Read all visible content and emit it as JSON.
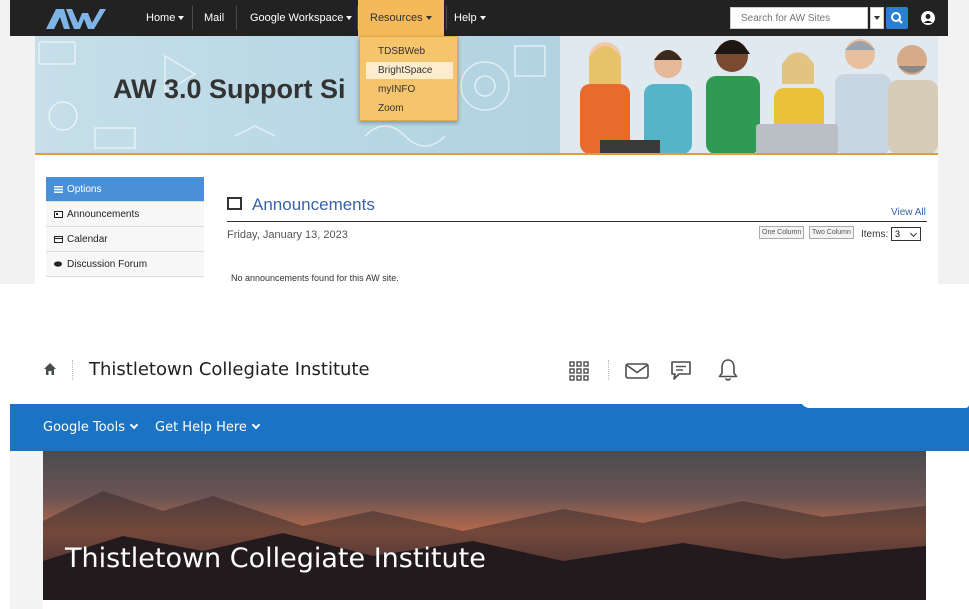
{
  "aw_site": {
    "nav": {
      "home": "Home",
      "mail": "Mail",
      "google_workspace": "Google Workspace",
      "resources": "Resources",
      "help": "Help",
      "search_placeholder": "Search for AW Sites"
    },
    "resources_menu": [
      "TDSBWeb",
      "BrightSpace",
      "myINFO",
      "Zoom"
    ],
    "resources_selected": "BrightSpace",
    "banner_title": "AW 3.0 Support Si",
    "sidebar": {
      "options": "Options",
      "items": [
        "Announcements",
        "Calendar",
        "Discussion Forum"
      ]
    },
    "announcements": {
      "title": "Announcements",
      "view_all": "View All",
      "date": "Friday, January 13, 2023",
      "one_column": "One Column",
      "two_column": "Two Column",
      "items_label": "Items:",
      "items_value": "3",
      "empty_message": "No announcements found for this AW site."
    },
    "colors": {
      "nav_bg": "#222222",
      "resources_highlight": "#f4b95a",
      "link_blue": "#3a62a8",
      "sidebar_active": "#4a90d9"
    }
  },
  "brightspace": {
    "org_name": "Thistletown Collegiate Institute",
    "menu": [
      "Google Tools",
      "Get Help Here"
    ],
    "hero_title": "Thistletown Collegiate Institute",
    "icons": [
      "home-icon",
      "waffle-grid-icon",
      "mail-icon",
      "chat-icon",
      "bell-icon"
    ],
    "colors": {
      "nav_bar": "#1b73c5"
    }
  }
}
